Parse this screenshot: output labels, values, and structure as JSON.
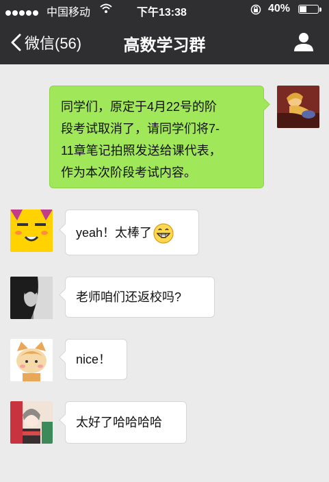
{
  "status_bar": {
    "carrier": "中国移动",
    "time": "下午13:38",
    "battery_percent": "40%",
    "battery_level": 0.4
  },
  "nav": {
    "back_label": "微信(56)",
    "title": "高数学习群"
  },
  "messages": [
    {
      "sender": "self",
      "text": "同学们，原定于4月22号的阶\n段考试取消了，请同学们将7-\n11章笔记拍照发送给课代表，\n作为本次阶段考试内容。"
    },
    {
      "sender": "other",
      "text": "yeah！太棒了",
      "emoji": "grinning-face"
    },
    {
      "sender": "other",
      "text": "老师咱们还返校吗?"
    },
    {
      "sender": "other",
      "text": "nice！"
    },
    {
      "sender": "other",
      "text": "太好了哈哈哈哈"
    }
  ]
}
